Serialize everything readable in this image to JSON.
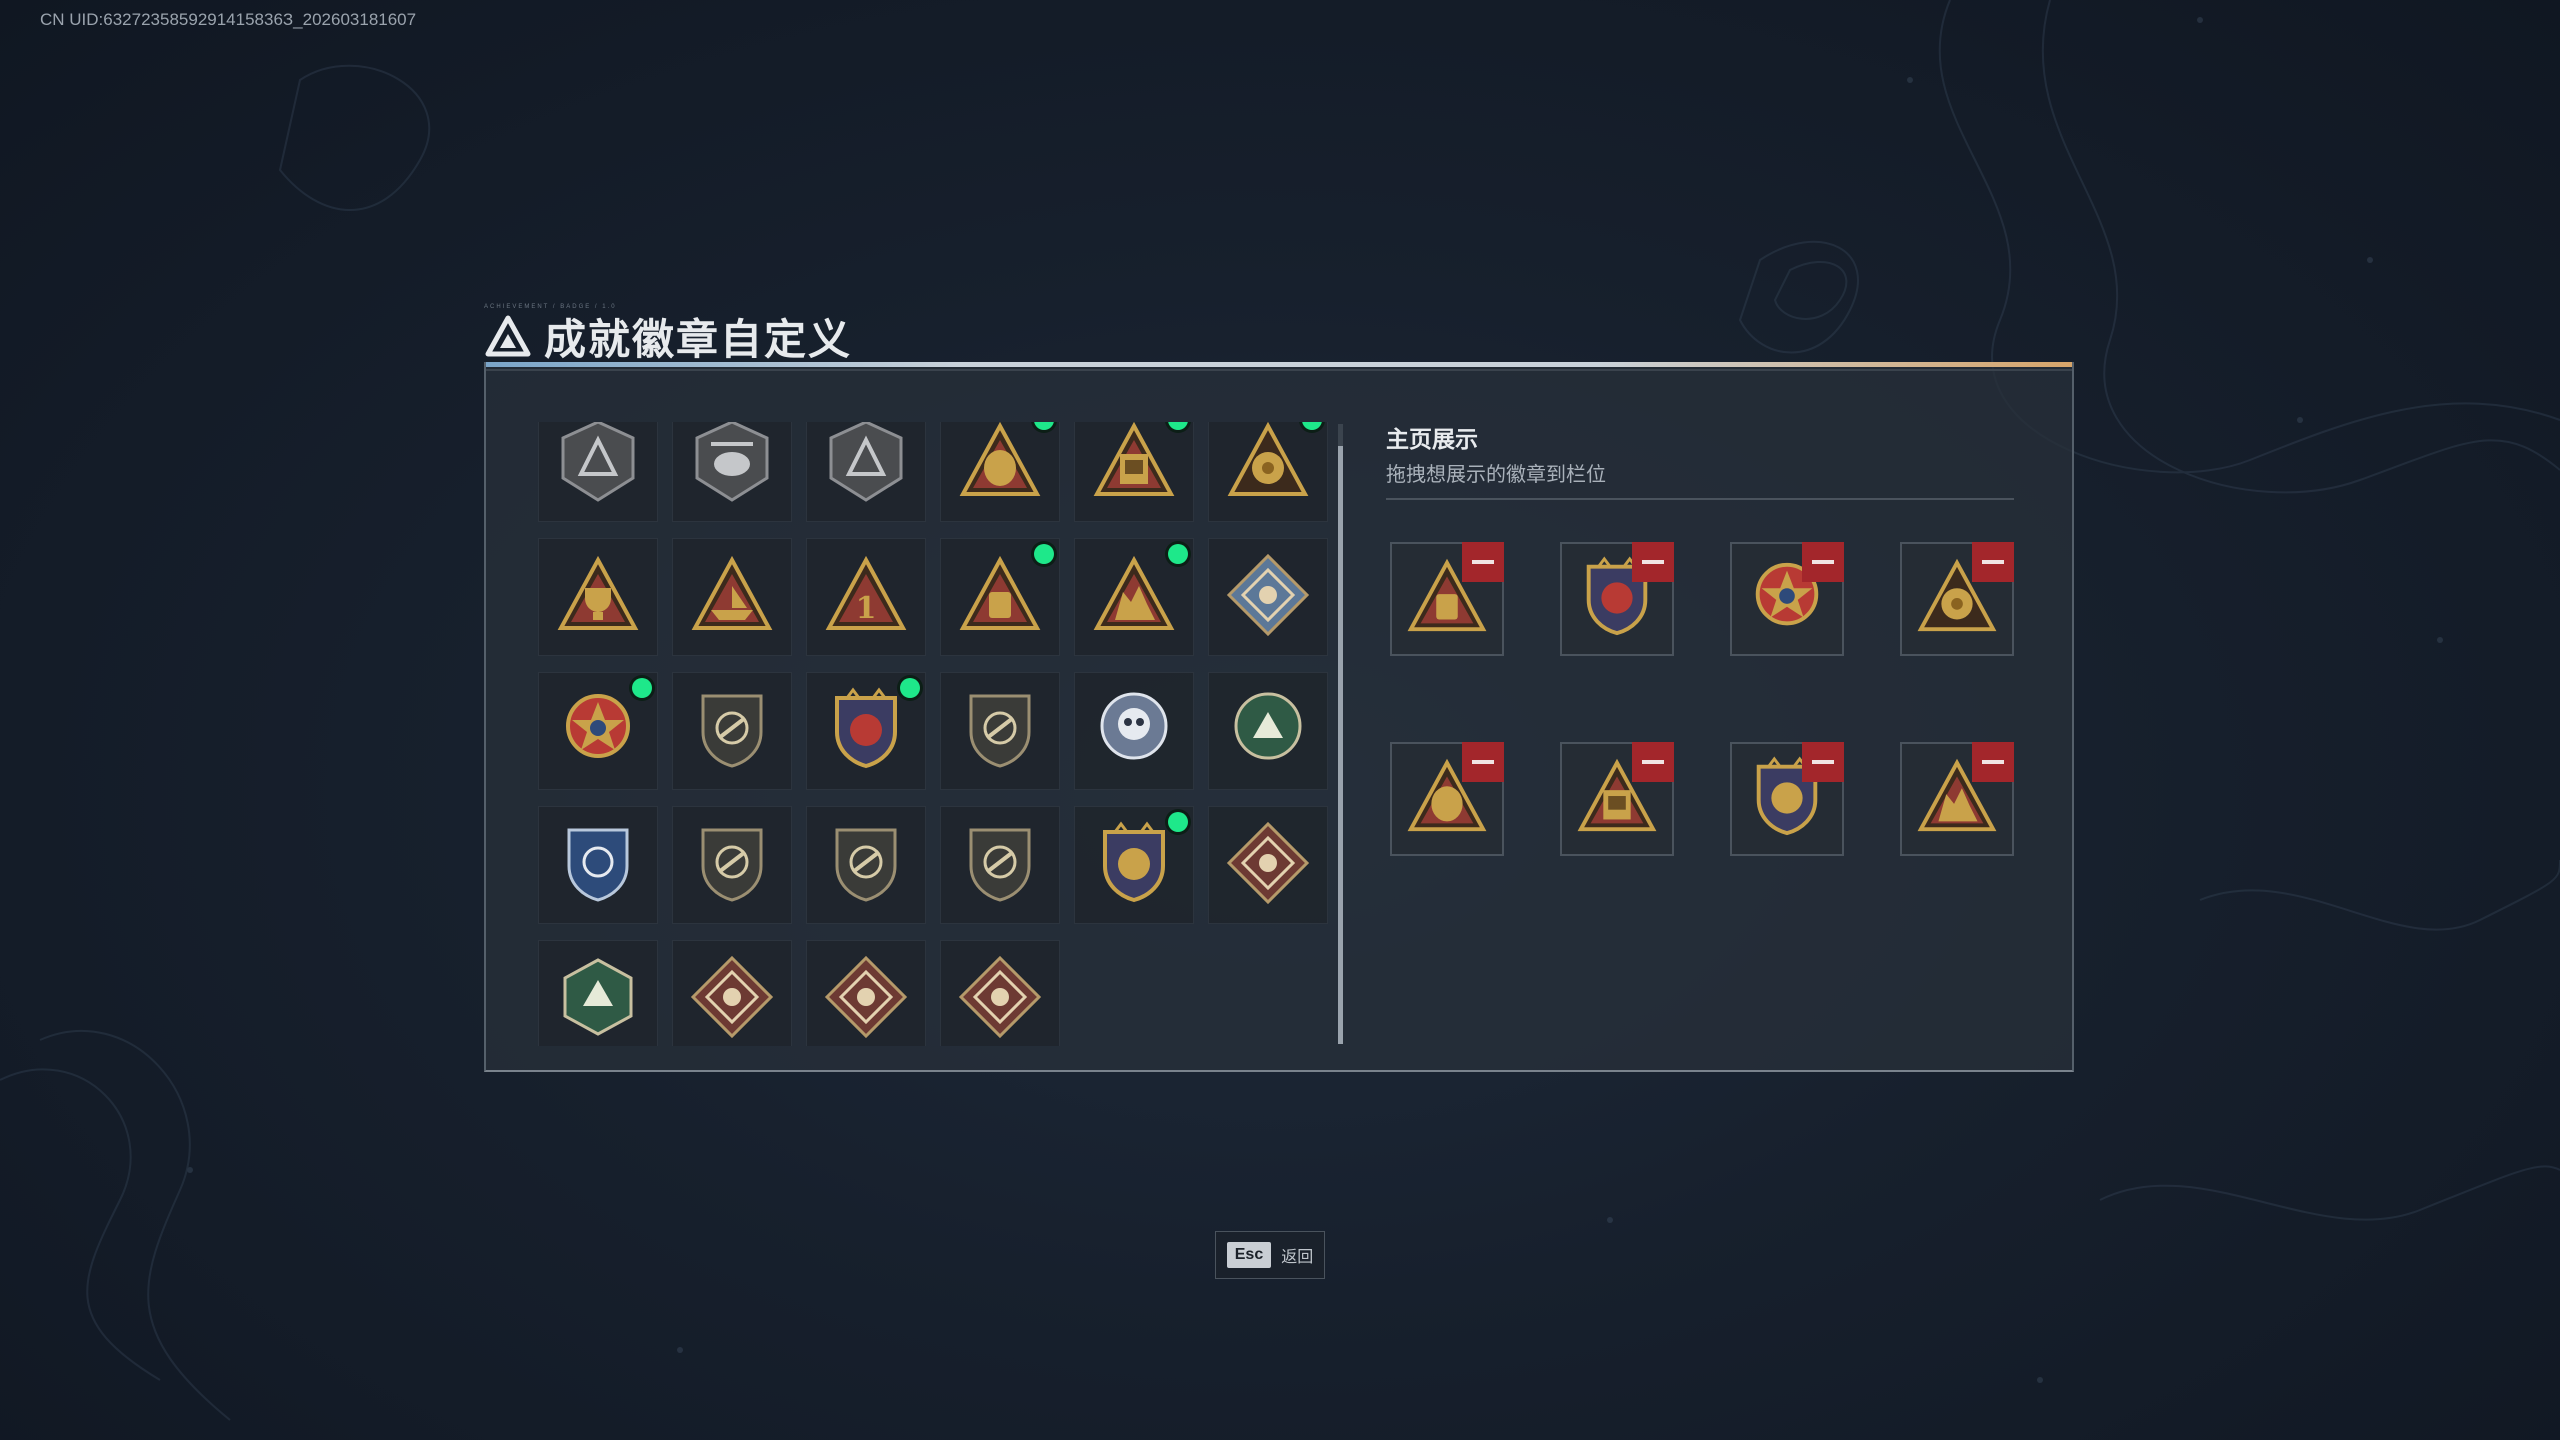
{
  "uid_text": "CN UID:6327235859291415836З_202603181607",
  "title": {
    "text": "成就徽章自定义",
    "deco_text": "ACHIEVEMENT / BADGE / 1.0"
  },
  "colors": {
    "new_dot": "#1ee88a",
    "remove": "#a3262b",
    "gold": "#c9a24a",
    "red_plate": "#8e3a32"
  },
  "badge_grid": {
    "items": [
      {
        "icon": "delta-shield-badge-icon",
        "new": false
      },
      {
        "icon": "helicopter-badge-icon",
        "new": false
      },
      {
        "icon": "winged-sword-badge-icon",
        "new": false
      },
      {
        "icon": "money-bag-55-badge-icon",
        "new": true
      },
      {
        "icon": "safe-box-badge-icon",
        "new": true
      },
      {
        "icon": "gold-medal-badge-icon",
        "new": true
      },
      {
        "icon": "trophy-triangle-badge-icon",
        "new": false
      },
      {
        "icon": "boat-triangle-badge-icon",
        "new": false
      },
      {
        "icon": "number-one-triangle-badge-icon",
        "new": false
      },
      {
        "icon": "container-triangle-badge-icon",
        "new": true
      },
      {
        "icon": "soldiers-triangle-badge-icon",
        "new": true
      },
      {
        "icon": "diamond-rifle-badge-icon",
        "new": false
      },
      {
        "icon": "star-medal-badge-icon",
        "new": true
      },
      {
        "icon": "shield-emblem-badge-icon",
        "new": false
      },
      {
        "icon": "stars-shield-badge-icon",
        "new": true
      },
      {
        "icon": "dark-shield-badge-icon",
        "new": false
      },
      {
        "icon": "skull-crosshair-badge-icon",
        "new": false
      },
      {
        "icon": "green-crest-badge-icon",
        "new": false
      },
      {
        "icon": "blue-crosshair-shield-badge-icon",
        "new": false
      },
      {
        "icon": "rifle-shield-badge-icon",
        "new": false
      },
      {
        "icon": "rifle-shield-alt-badge-icon",
        "new": false
      },
      {
        "icon": "scope-shield-badge-icon",
        "new": false
      },
      {
        "icon": "crossed-rifles-crest-badge-icon",
        "new": true
      },
      {
        "icon": "wolf-diamond-badge-icon",
        "new": false
      },
      {
        "icon": "green-hex-weapon-badge-icon",
        "new": false
      },
      {
        "icon": "dragon-diamond-badge-icon",
        "new": false
      },
      {
        "icon": "runner-diamond-badge-icon",
        "new": false
      },
      {
        "icon": "rifle-diamond-badge-icon",
        "new": false
      }
    ]
  },
  "showcase": {
    "title": "主页展示",
    "subtitle": "拖拽想展示的徽章到栏位",
    "slots": [
      {
        "icon": "container-triangle-badge-icon"
      },
      {
        "icon": "stars-shield-badge-icon"
      },
      {
        "icon": "star-medal-badge-icon"
      },
      {
        "icon": "gold-medal-badge-icon"
      },
      {
        "icon": "money-bag-55-badge-icon"
      },
      {
        "icon": "safe-box-badge-icon"
      },
      {
        "icon": "crossed-rifles-crest-badge-icon"
      },
      {
        "icon": "soldiers-triangle-badge-icon"
      }
    ]
  },
  "footer": {
    "esc_key": "Esc",
    "esc_label": "返回"
  }
}
